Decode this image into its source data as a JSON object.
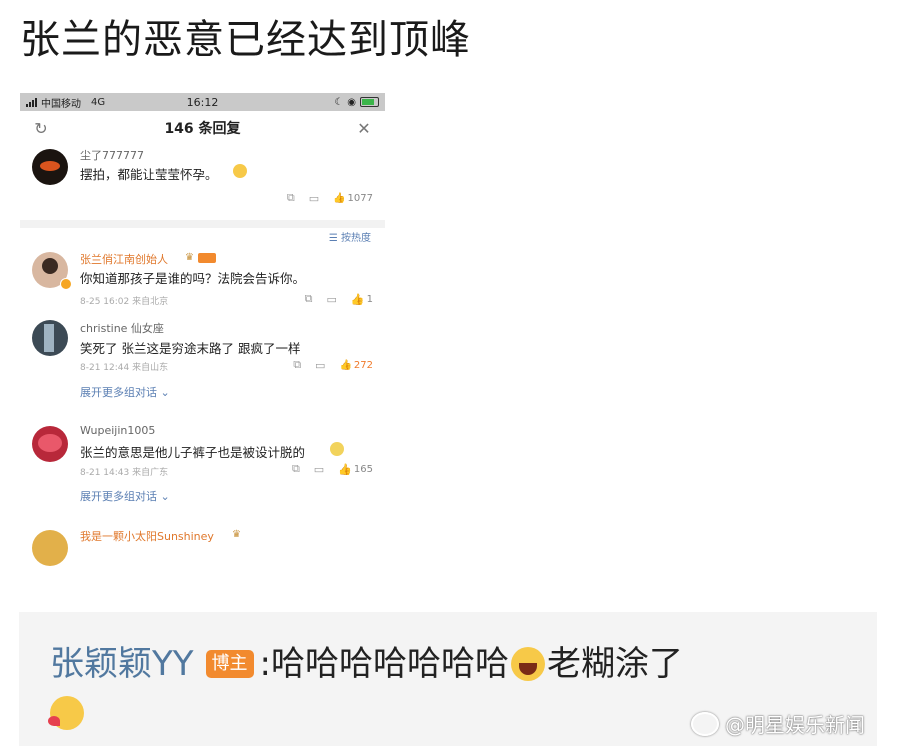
{
  "page": {
    "title": "张兰的恶意已经达到顶峰"
  },
  "phone": {
    "status": {
      "carrier": "中国移动",
      "network": "4G",
      "time": "16:12"
    },
    "header": {
      "title": "146 条回复"
    },
    "top_comment": {
      "user": "尘了777777",
      "text": "摆拍，都能让莹莹怀孕。",
      "likes": "1077"
    },
    "sort_label": "按热度",
    "replies": [
      {
        "user": "张兰俏江南创始人",
        "text": "你知道那孩子是谁的吗？法院会告诉你。",
        "meta": "8-25 16:02  来自北京",
        "likes": "1",
        "expand": ""
      },
      {
        "user": "christine 仙女座",
        "text": "笑死了 张兰这是穷途末路了 跟疯了一样",
        "meta": "8-21 12:44  来自山东",
        "likes": "272",
        "expand": "展开更多组对话"
      },
      {
        "user": "Wupeijin1005",
        "text": "张兰的意思是他儿子裤子也是被设计脱的",
        "meta": "8-21 14:43  来自广东",
        "likes": "165",
        "expand": "展开更多组对话"
      },
      {
        "user": "我是一颗小太阳Sunshiney",
        "text": "",
        "meta": "",
        "likes": "",
        "expand": ""
      }
    ]
  },
  "quote": {
    "name": "张颖颖YY",
    "badge": "博主",
    "text_a": ":哈哈哈哈哈哈哈",
    "text_b": "老糊涂了"
  },
  "watermark": "@明星娱乐新闻",
  "colors": {
    "accent_link": "#5b7fb3",
    "like_active": "#f07a2b",
    "quote_name": "#51789f",
    "badge": "#f28a2e"
  }
}
